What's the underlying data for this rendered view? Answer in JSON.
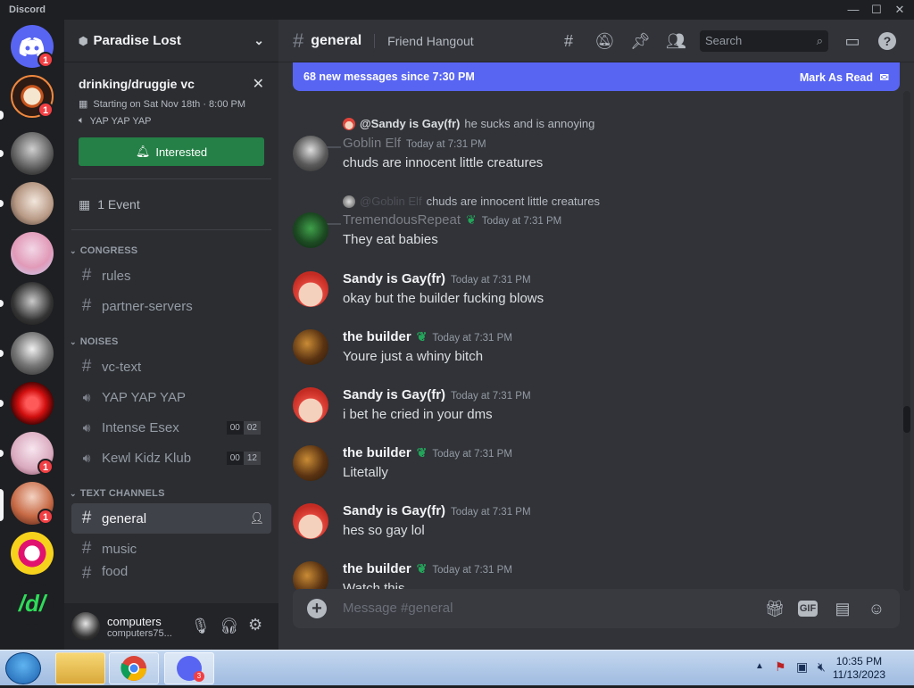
{
  "window": {
    "app_name": "Discord",
    "minimize": "—",
    "maximize": "☐",
    "close": "✕"
  },
  "servers": {
    "badges": [
      "1",
      "1",
      "1",
      "1"
    ],
    "brand_text": "/d/"
  },
  "guild": {
    "name": "Paradise Lost"
  },
  "event": {
    "title": "drinking/druggie vc",
    "when": "Starting on Sat Nov 18th · 8:00 PM",
    "location": "YAP YAP YAP",
    "interested_label": "Interested",
    "events_count": "1 Event"
  },
  "categories": {
    "congress": "CONGRESS",
    "noises": "NOISES",
    "text": "TEXT CHANNELS"
  },
  "channels": {
    "congress": [
      "rules",
      "partner-servers"
    ],
    "noises": [
      {
        "name": "vc-text",
        "type": "text"
      },
      {
        "name": "YAP YAP YAP",
        "type": "voice"
      },
      {
        "name": "Intense Esex",
        "type": "voice",
        "count": [
          "00",
          "02"
        ]
      },
      {
        "name": "Kewl Kidz Klub",
        "type": "voice",
        "count": [
          "00",
          "12"
        ]
      }
    ],
    "text": [
      "general",
      "music",
      "food"
    ]
  },
  "user": {
    "name": "computers",
    "tag": "computers75..."
  },
  "header": {
    "channel": "general",
    "topic": "Friend Hangout",
    "search_placeholder": "Search"
  },
  "new_messages": {
    "text": "68 new messages since 7:30 PM",
    "action": "Mark As Read"
  },
  "messages": [
    {
      "reply_to": "@Sandy is Gay(fr)",
      "reply_text": "he sucks and is annoying",
      "author": "Goblin Elf",
      "ts": "Today at 7:31 PM",
      "content": "chuds are innocent little creatures"
    },
    {
      "reply_to": "@Goblin Elf",
      "reply_text": "chuds are innocent little creatures",
      "author": "TremendousRepeat",
      "ts": "Today at 7:31 PM",
      "content": "They eat babies"
    },
    {
      "author": "Sandy is Gay(fr)",
      "ts": "Today at 7:31 PM",
      "content": "okay but the builder fucking blows"
    },
    {
      "author": "the builder",
      "ts": "Today at 7:31 PM",
      "content": "Youre just a whiny bitch"
    },
    {
      "author": "Sandy is Gay(fr)",
      "ts": "Today at 7:31 PM",
      "content": "i bet he cried in your dms"
    },
    {
      "author": "the builder",
      "ts": "Today at 7:31 PM",
      "content": "Litetally"
    },
    {
      "author": "Sandy is Gay(fr)",
      "ts": "Today at 7:31 PM",
      "content": "hes so gay lol"
    },
    {
      "author": "the builder",
      "ts": "Today at 7:31 PM",
      "content": "Watch this"
    }
  ],
  "composer": {
    "placeholder": "Message #general",
    "gif": "GIF"
  },
  "taskbar": {
    "time": "10:35 PM",
    "date": "11/13/2023",
    "discord_badge": "3"
  },
  "colors": {
    "accent": "#5865f2",
    "green": "#248046",
    "danger": "#f23f43"
  }
}
